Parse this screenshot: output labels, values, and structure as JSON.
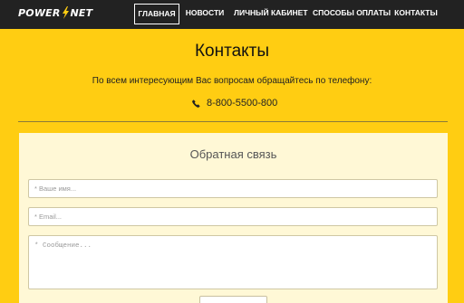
{
  "brand": {
    "left": "POWER",
    "right": "NET"
  },
  "nav": {
    "items": [
      {
        "label": "ГЛАВНАЯ",
        "active": true
      },
      {
        "label": "НОВОСТИ",
        "active": false
      },
      {
        "label": "ЛИЧНЫЙ КАБИНЕТ",
        "active": false
      },
      {
        "label": "СПОСОБЫ ОПЛАТЫ",
        "active": false
      },
      {
        "label": "КОНТАКТЫ",
        "active": false
      }
    ]
  },
  "page": {
    "title": "Контакты",
    "subtitle": "По всем интересующим Вас вопросам обращайтесь по телефону:",
    "phone": "8-800-5500-800",
    "phone_icon": "phone-icon"
  },
  "form": {
    "title": "Обратная связь",
    "name_placeholder": "* Ваше имя...",
    "email_placeholder": "* Email...",
    "message_placeholder": "* Сообщение..."
  },
  "colors": {
    "accent": "#ffcd12",
    "navbar": "#222222",
    "panel": "#fff8d6"
  }
}
